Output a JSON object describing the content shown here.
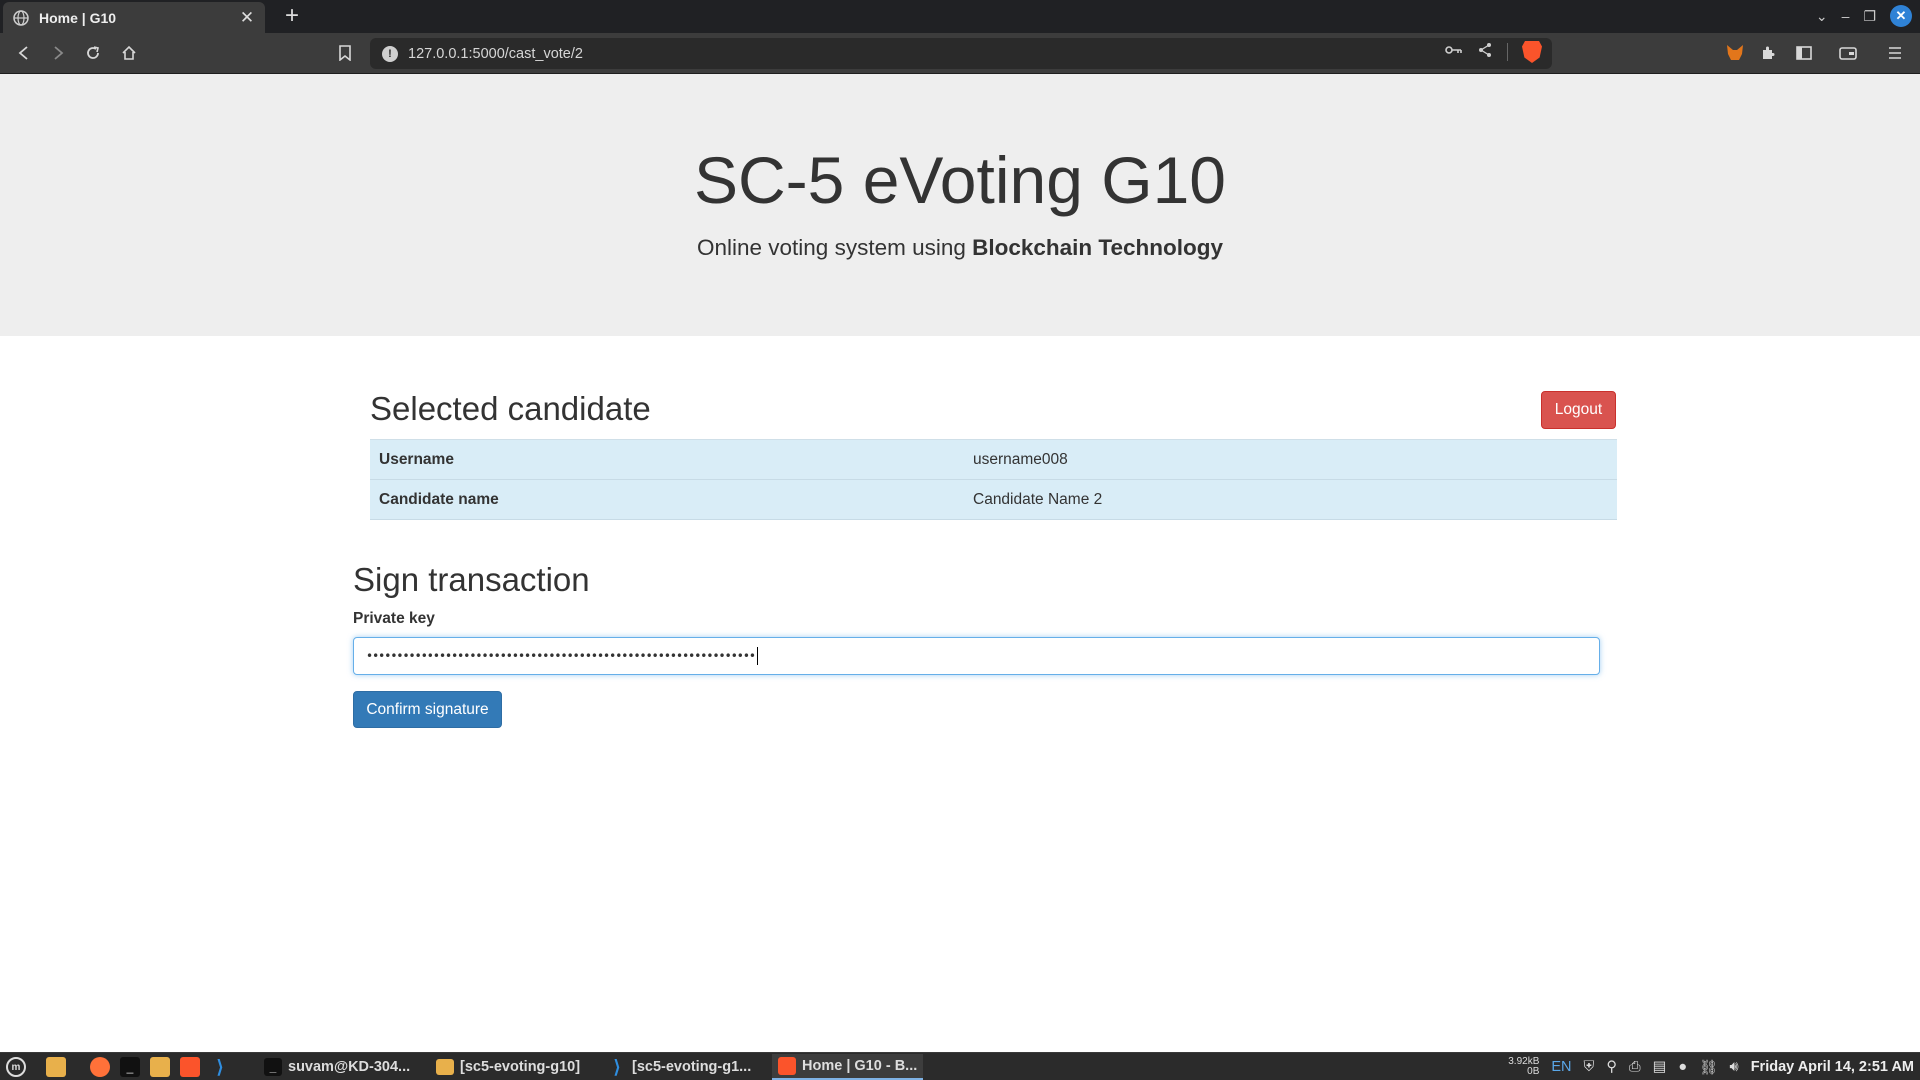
{
  "browser": {
    "tab_title": "Home | G10",
    "url": "127.0.0.1:5000/cast_vote/2",
    "window_controls": {
      "minimize": "–",
      "maximize": "❐",
      "close": "✕"
    }
  },
  "header": {
    "title": "SC-5 eVoting G10",
    "subtitle_prefix": "Online voting system using ",
    "subtitle_bold": "Blockchain Technology"
  },
  "selected": {
    "heading": "Selected candidate",
    "logout_label": "Logout",
    "rows": [
      {
        "key": "Username",
        "value": "username008"
      },
      {
        "key": "Candidate name",
        "value": "Candidate Name 2"
      }
    ]
  },
  "sign": {
    "heading": "Sign transaction",
    "private_key_label": "Private key",
    "private_key_masked": "••••••••••••••••••••••••••••••••••••••••••••••••••••••••••••••••",
    "confirm_label": "Confirm signature"
  },
  "taskbar": {
    "windows": [
      {
        "label": "suvam@KD-304...",
        "icon": "terminal-icon"
      },
      {
        "label": "[sc5-evoting-g10]",
        "icon": "folder-icon"
      },
      {
        "label": "[sc5-evoting-g1...",
        "icon": "vscode-icon"
      },
      {
        "label": "Home | G10 - B...",
        "icon": "brave-icon"
      }
    ],
    "net_up": "3.92kB",
    "net_down": "0B",
    "lang": "EN",
    "clock": "Friday April 14,  2:51 AM"
  },
  "colors": {
    "jumbotron_bg": "#eeeeee",
    "logout_red": "#d9534f",
    "confirm_blue": "#337ab7",
    "table_row_bg": "#d9edf7"
  }
}
